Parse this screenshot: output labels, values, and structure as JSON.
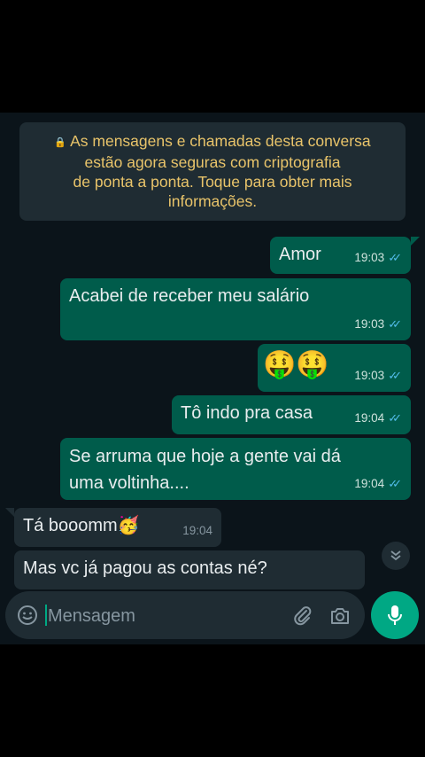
{
  "notice": {
    "line1": "As mensagens e chamadas desta conversa",
    "line2": "estão agora seguras com criptografia",
    "line3": "de ponta a ponta. Toque para obter mais",
    "line4": "informações."
  },
  "messages": [
    {
      "dir": "out",
      "text": "Amor",
      "time": "19:03"
    },
    {
      "dir": "out",
      "text": "Acabei de receber meu salário",
      "time": "19:03"
    },
    {
      "dir": "out",
      "text": "🤑🤑",
      "time": "19:03"
    },
    {
      "dir": "out",
      "text": "Tô indo pra casa",
      "time": "19:04"
    },
    {
      "dir": "out",
      "text_line1": "Se arruma que hoje a gente vai dá",
      "text_line2": "uma voltinha....",
      "time": "19:04"
    },
    {
      "dir": "in",
      "text": "Tá booomm🥳",
      "time": "19:04"
    },
    {
      "dir": "in",
      "text": "Mas vc já pagou as contas né?"
    }
  ],
  "input": {
    "placeholder": "Mensagem"
  },
  "icons": {
    "emoji": "emoji-icon",
    "attach": "paperclip-icon",
    "camera": "camera-icon",
    "mic": "mic-icon",
    "scroll": "chevron-double-down-icon",
    "read": "double-check-icon",
    "lock": "lock-icon"
  },
  "colors": {
    "background": "#0b141a",
    "outgoing_bubble": "#005c4b",
    "incoming_bubble": "#1f2c33",
    "notice_text": "#e9c46a",
    "read_ticks": "#53bdeb",
    "accent": "#00a884"
  }
}
